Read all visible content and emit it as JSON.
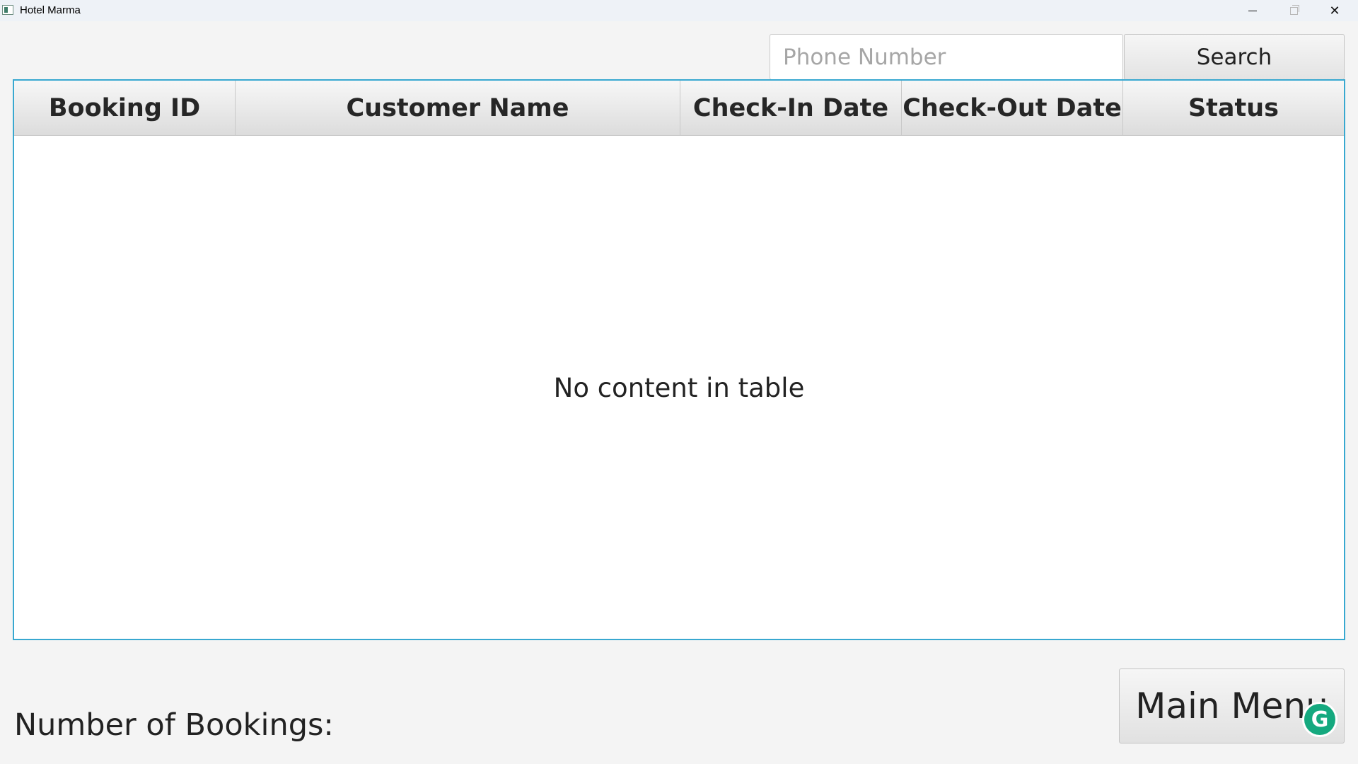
{
  "window": {
    "title": "Hotel Marma",
    "controls": {
      "minimize_icon": "minimize-icon",
      "maximize_icon": "maximize-icon",
      "close_icon": "close-icon",
      "close_glyph": "✕"
    }
  },
  "search": {
    "placeholder": "Phone Number",
    "value": "",
    "button_label": "Search"
  },
  "table": {
    "columns": [
      "Booking ID",
      "Customer Name",
      "Check-In Date",
      "Check-Out Date",
      "Status"
    ],
    "rows": [],
    "empty_message": "No content in table",
    "border_color": "#38a8d0"
  },
  "footer": {
    "bookings_label": "Number of Bookings:",
    "main_menu_label": "Main Menu"
  },
  "overlay": {
    "grammarly_letter": "G",
    "grammarly_color": "#15a97f"
  }
}
